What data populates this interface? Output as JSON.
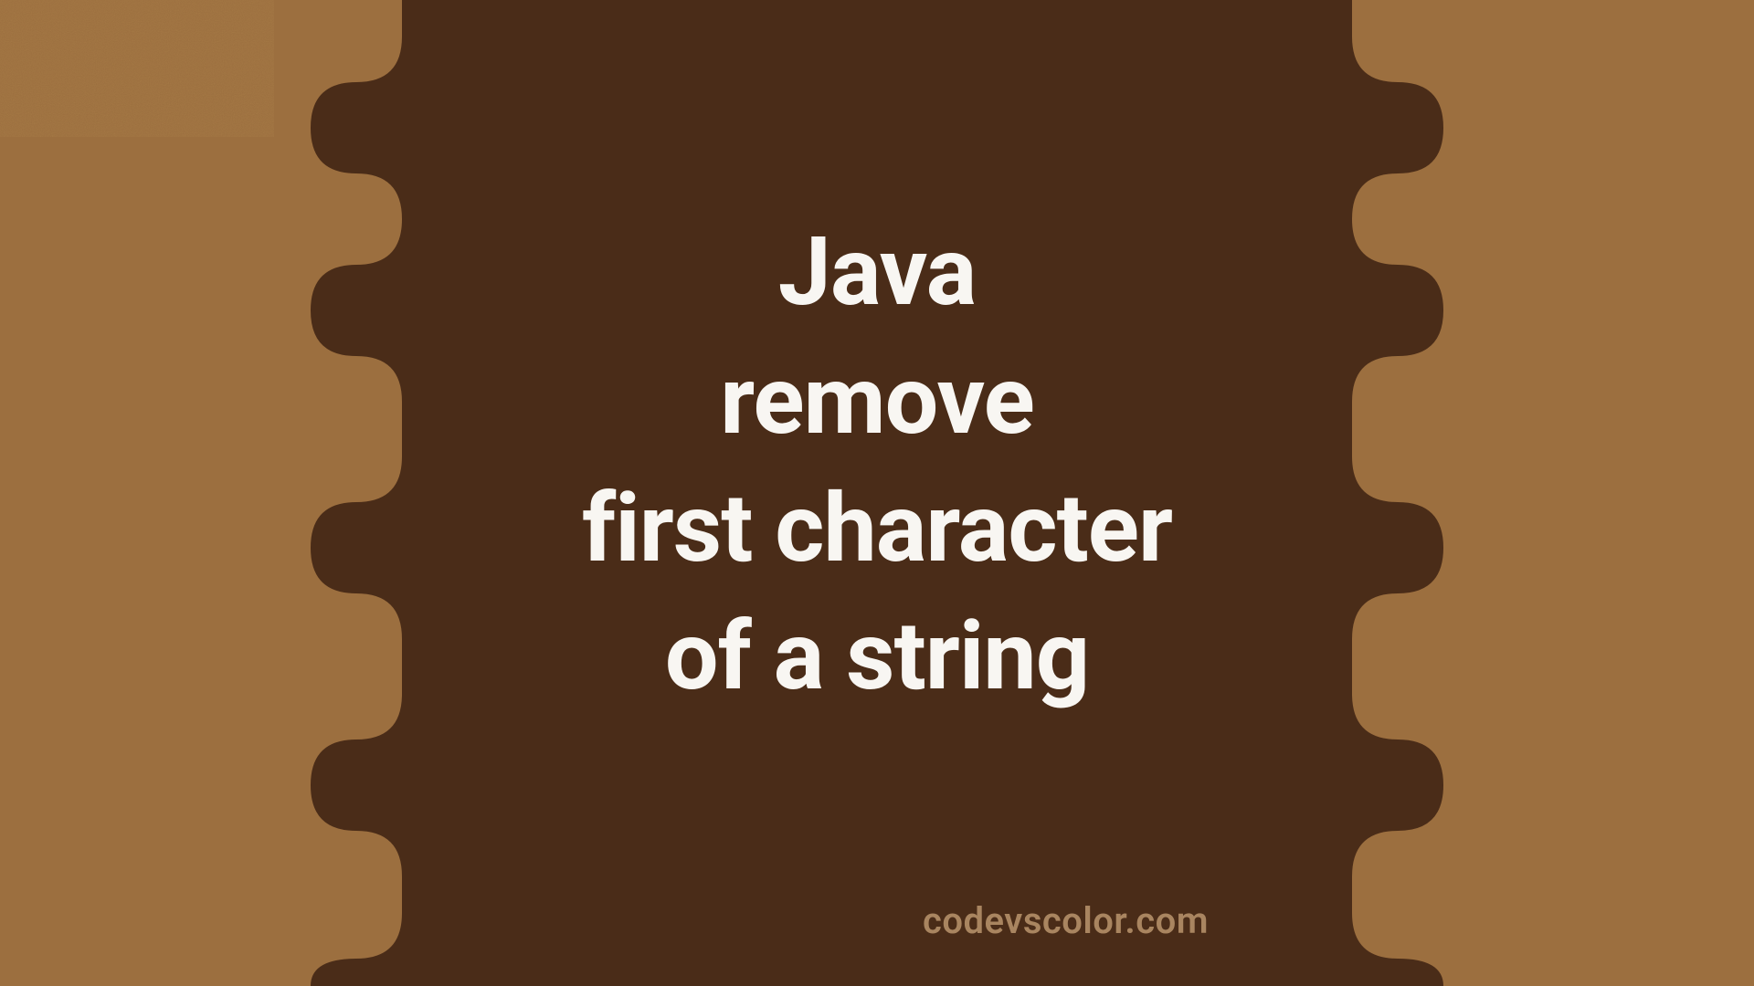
{
  "colors": {
    "bg_outer": "#9c6f3f",
    "bg_inner": "#4a2c18",
    "text_main": "#f8f6f2",
    "text_watermark": "#a98560"
  },
  "title": {
    "line1": "Java",
    "line2": "remove",
    "line3": "first character",
    "line4": "of a string"
  },
  "watermark": "codevscolor.com"
}
